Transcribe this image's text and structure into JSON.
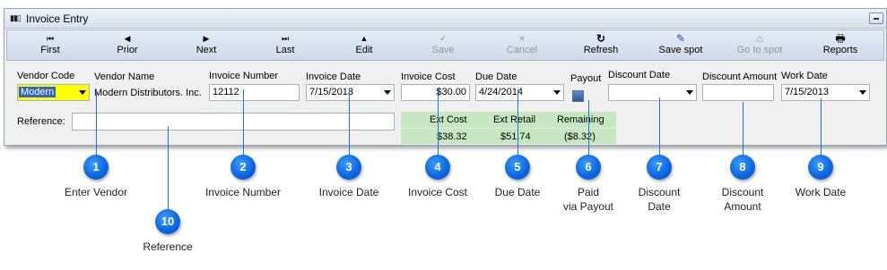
{
  "window": {
    "title": "Invoice Entry"
  },
  "toolbar": {
    "buttons": [
      {
        "label": "First",
        "icon": "⏮",
        "enabled": true
      },
      {
        "label": "Prior",
        "icon": "◀",
        "enabled": true
      },
      {
        "label": "Next",
        "icon": "▶",
        "enabled": true
      },
      {
        "label": "Last",
        "icon": "⏭",
        "enabled": true
      },
      {
        "label": "Edit",
        "icon": "▲",
        "enabled": true
      },
      {
        "label": "Save",
        "icon": "✓",
        "enabled": false
      },
      {
        "label": "Cancel",
        "icon": "✕",
        "enabled": false
      },
      {
        "label": "Refresh",
        "icon": "↻",
        "enabled": true
      },
      {
        "label": "Save spot",
        "icon": "✎",
        "enabled": true
      },
      {
        "label": "Go to spot",
        "icon": "⌂",
        "enabled": false
      },
      {
        "label": "Reports",
        "icon": "🖶",
        "enabled": true
      }
    ]
  },
  "form": {
    "vendor_code": {
      "label": "Vendor Code",
      "value": "Modern"
    },
    "vendor_name": {
      "label": "Vendor Name",
      "value": "Modern Distributors. Inc."
    },
    "invoice_number": {
      "label": "Invoice Number",
      "value": "12112"
    },
    "invoice_date": {
      "label": "Invoice Date",
      "value": "7/15/2013"
    },
    "invoice_cost": {
      "label": "Invoice Cost",
      "value": "$30.00"
    },
    "due_date": {
      "label": "Due Date",
      "value": "4/24/2014"
    },
    "payout": {
      "label": "Payout"
    },
    "discount_date": {
      "label": "Discount Date",
      "value": ""
    },
    "discount_amount": {
      "label": "Discount Amount",
      "value": ""
    },
    "work_date": {
      "label": "Work Date",
      "value": "7/15/2013"
    },
    "reference": {
      "label": "Reference:",
      "value": ""
    }
  },
  "summary": {
    "ext_cost": {
      "label": "Ext Cost",
      "value": "$38.32"
    },
    "ext_retail": {
      "label": "Ext Retail",
      "value": "$51.74"
    },
    "remaining": {
      "label": "Remaining",
      "value": "($8.32)"
    }
  },
  "callouts": [
    {
      "number": "1",
      "caption": "Enter Vendor"
    },
    {
      "number": "2",
      "caption": "Invoice Number"
    },
    {
      "number": "3",
      "caption": "Invoice Date"
    },
    {
      "number": "4",
      "caption": "Invoice Cost"
    },
    {
      "number": "5",
      "caption": "Due Date"
    },
    {
      "number": "6",
      "caption_line1": "Paid",
      "caption_line2": "via Payout"
    },
    {
      "number": "7",
      "caption_line1": "Discount",
      "caption_line2": "Date"
    },
    {
      "number": "8",
      "caption_line1": "Discount",
      "caption_line2": "Amount"
    },
    {
      "number": "9",
      "caption": "Work Date"
    },
    {
      "number": "10",
      "caption": "Reference"
    }
  ]
}
